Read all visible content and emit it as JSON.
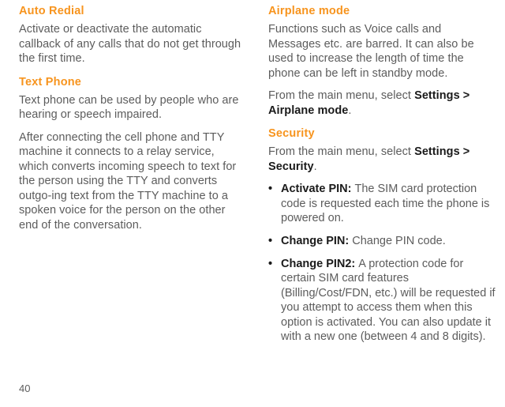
{
  "left": {
    "h1": "Auto Redial",
    "p1": "Activate or deactivate the automatic callback of any calls that do not get through the first time.",
    "h2": "Text Phone",
    "p2": "Text phone can be used by people who are hearing or speech impaired.",
    "p3": "After connecting the cell phone and TTY machine it connects to a relay service, which converts incoming speech to text for the person using the TTY and converts outgo-ing text from the TTY machine to a spoken voice for the person on the other end of the conversation."
  },
  "right": {
    "h1": "Airplane mode",
    "p1": "Functions such as Voice calls and Messages etc. are barred. It can also be used to increase the length of time the phone can be left in standby mode.",
    "p2_a": "From the main menu, select ",
    "p2_b": "Settings > Airplane mode",
    "p2_c": ".",
    "h2": "Security",
    "p3_a": "From the main menu, select ",
    "p3_b": "Settings > Security",
    "p3_c": ".",
    "li1_b": "Activate PIN: ",
    "li1_t": "The SIM card protection code is requested each time the phone is powered on.",
    "li2_b": "Change PIN: ",
    "li2_t": "Change PIN code.",
    "li3_b": "Change PIN2: ",
    "li3_t": "A protection code for certain SIM card features (Billing/Cost/FDN, etc.) will be requested if you attempt to access them when this option is activated. You can also update it with a new one (between 4 and 8 digits)."
  },
  "page_number": "40"
}
